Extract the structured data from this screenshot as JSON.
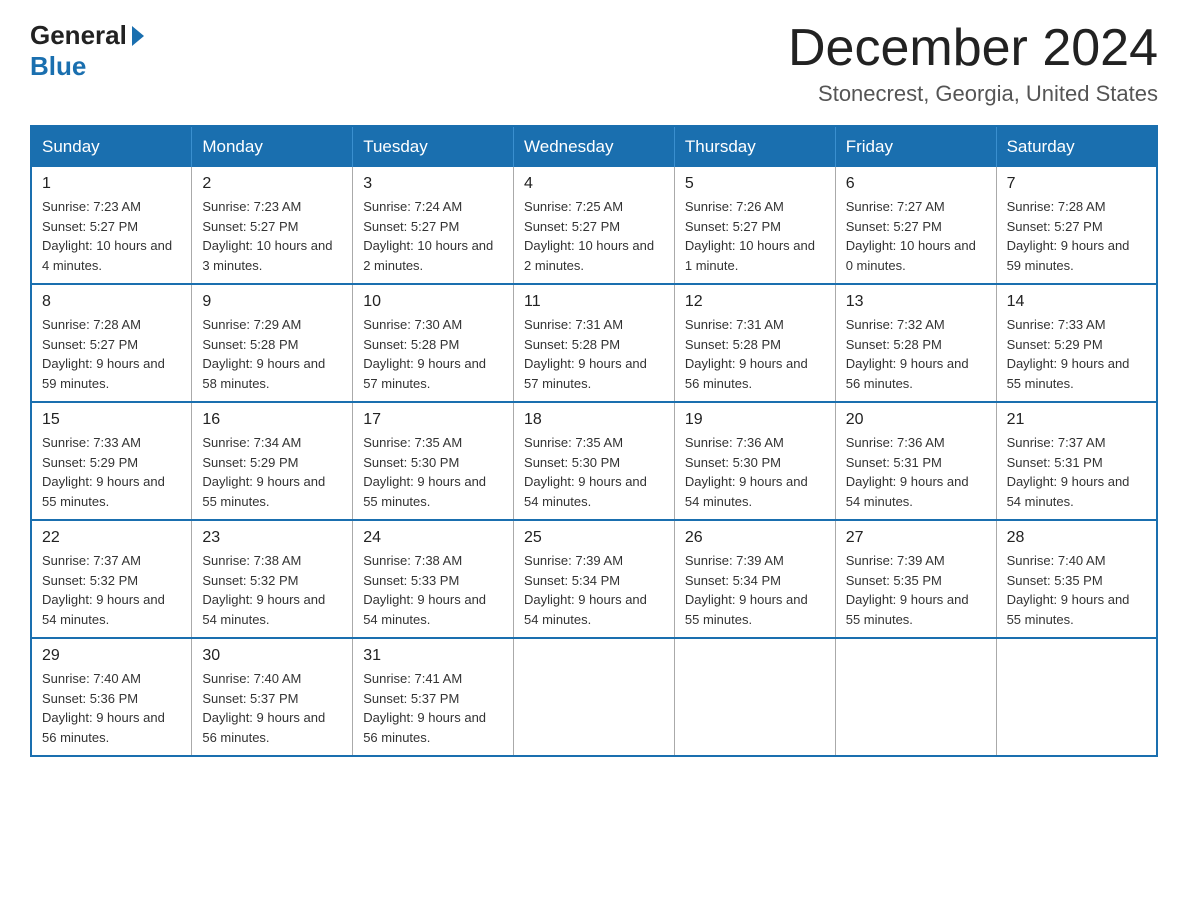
{
  "header": {
    "logo_general": "General",
    "logo_blue": "Blue",
    "month_title": "December 2024",
    "subtitle": "Stonecrest, Georgia, United States"
  },
  "days_of_week": [
    "Sunday",
    "Monday",
    "Tuesday",
    "Wednesday",
    "Thursday",
    "Friday",
    "Saturday"
  ],
  "weeks": [
    [
      {
        "day": 1,
        "sunrise": "7:23 AM",
        "sunset": "5:27 PM",
        "daylight": "10 hours and 4 minutes."
      },
      {
        "day": 2,
        "sunrise": "7:23 AM",
        "sunset": "5:27 PM",
        "daylight": "10 hours and 3 minutes."
      },
      {
        "day": 3,
        "sunrise": "7:24 AM",
        "sunset": "5:27 PM",
        "daylight": "10 hours and 2 minutes."
      },
      {
        "day": 4,
        "sunrise": "7:25 AM",
        "sunset": "5:27 PM",
        "daylight": "10 hours and 2 minutes."
      },
      {
        "day": 5,
        "sunrise": "7:26 AM",
        "sunset": "5:27 PM",
        "daylight": "10 hours and 1 minute."
      },
      {
        "day": 6,
        "sunrise": "7:27 AM",
        "sunset": "5:27 PM",
        "daylight": "10 hours and 0 minutes."
      },
      {
        "day": 7,
        "sunrise": "7:28 AM",
        "sunset": "5:27 PM",
        "daylight": "9 hours and 59 minutes."
      }
    ],
    [
      {
        "day": 8,
        "sunrise": "7:28 AM",
        "sunset": "5:27 PM",
        "daylight": "9 hours and 59 minutes."
      },
      {
        "day": 9,
        "sunrise": "7:29 AM",
        "sunset": "5:28 PM",
        "daylight": "9 hours and 58 minutes."
      },
      {
        "day": 10,
        "sunrise": "7:30 AM",
        "sunset": "5:28 PM",
        "daylight": "9 hours and 57 minutes."
      },
      {
        "day": 11,
        "sunrise": "7:31 AM",
        "sunset": "5:28 PM",
        "daylight": "9 hours and 57 minutes."
      },
      {
        "day": 12,
        "sunrise": "7:31 AM",
        "sunset": "5:28 PM",
        "daylight": "9 hours and 56 minutes."
      },
      {
        "day": 13,
        "sunrise": "7:32 AM",
        "sunset": "5:28 PM",
        "daylight": "9 hours and 56 minutes."
      },
      {
        "day": 14,
        "sunrise": "7:33 AM",
        "sunset": "5:29 PM",
        "daylight": "9 hours and 55 minutes."
      }
    ],
    [
      {
        "day": 15,
        "sunrise": "7:33 AM",
        "sunset": "5:29 PM",
        "daylight": "9 hours and 55 minutes."
      },
      {
        "day": 16,
        "sunrise": "7:34 AM",
        "sunset": "5:29 PM",
        "daylight": "9 hours and 55 minutes."
      },
      {
        "day": 17,
        "sunrise": "7:35 AM",
        "sunset": "5:30 PM",
        "daylight": "9 hours and 55 minutes."
      },
      {
        "day": 18,
        "sunrise": "7:35 AM",
        "sunset": "5:30 PM",
        "daylight": "9 hours and 54 minutes."
      },
      {
        "day": 19,
        "sunrise": "7:36 AM",
        "sunset": "5:30 PM",
        "daylight": "9 hours and 54 minutes."
      },
      {
        "day": 20,
        "sunrise": "7:36 AM",
        "sunset": "5:31 PM",
        "daylight": "9 hours and 54 minutes."
      },
      {
        "day": 21,
        "sunrise": "7:37 AM",
        "sunset": "5:31 PM",
        "daylight": "9 hours and 54 minutes."
      }
    ],
    [
      {
        "day": 22,
        "sunrise": "7:37 AM",
        "sunset": "5:32 PM",
        "daylight": "9 hours and 54 minutes."
      },
      {
        "day": 23,
        "sunrise": "7:38 AM",
        "sunset": "5:32 PM",
        "daylight": "9 hours and 54 minutes."
      },
      {
        "day": 24,
        "sunrise": "7:38 AM",
        "sunset": "5:33 PM",
        "daylight": "9 hours and 54 minutes."
      },
      {
        "day": 25,
        "sunrise": "7:39 AM",
        "sunset": "5:34 PM",
        "daylight": "9 hours and 54 minutes."
      },
      {
        "day": 26,
        "sunrise": "7:39 AM",
        "sunset": "5:34 PM",
        "daylight": "9 hours and 55 minutes."
      },
      {
        "day": 27,
        "sunrise": "7:39 AM",
        "sunset": "5:35 PM",
        "daylight": "9 hours and 55 minutes."
      },
      {
        "day": 28,
        "sunrise": "7:40 AM",
        "sunset": "5:35 PM",
        "daylight": "9 hours and 55 minutes."
      }
    ],
    [
      {
        "day": 29,
        "sunrise": "7:40 AM",
        "sunset": "5:36 PM",
        "daylight": "9 hours and 56 minutes."
      },
      {
        "day": 30,
        "sunrise": "7:40 AM",
        "sunset": "5:37 PM",
        "daylight": "9 hours and 56 minutes."
      },
      {
        "day": 31,
        "sunrise": "7:41 AM",
        "sunset": "5:37 PM",
        "daylight": "9 hours and 56 minutes."
      },
      null,
      null,
      null,
      null
    ]
  ]
}
